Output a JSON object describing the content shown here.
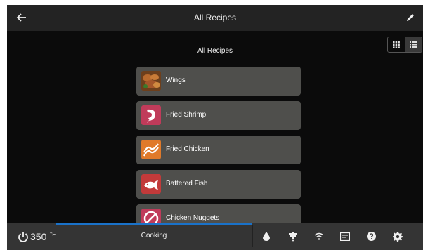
{
  "header": {
    "title": "All Recipes"
  },
  "subtitle": "All Recipes",
  "recipes": [
    {
      "label": "Wings",
      "icon": "wings-photo-icon",
      "color": "#9a5a2a"
    },
    {
      "label": "Fried Shrimp",
      "icon": "shrimp-icon",
      "color": "#c03b5a"
    },
    {
      "label": "Fried Chicken",
      "icon": "bacon-strips-icon",
      "color": "#e07a2a"
    },
    {
      "label": "Battered Fish",
      "icon": "fish-icon",
      "color": "#c23a3a"
    },
    {
      "label": "Chicken Nuggets",
      "icon": "no-symbol-icon",
      "color": "#c03b5a"
    }
  ],
  "footer": {
    "temperature": "350",
    "temperature_unit": "°F",
    "status": "Cooking",
    "icons": [
      "water-drop-icon",
      "faucet-icon",
      "wifi-icon",
      "display-icon",
      "help-icon",
      "settings-icon"
    ]
  },
  "colors": {
    "progress": "#1a72c9",
    "background": "#0b0b0b",
    "header": "#232323",
    "item": "#4f4f4c"
  }
}
